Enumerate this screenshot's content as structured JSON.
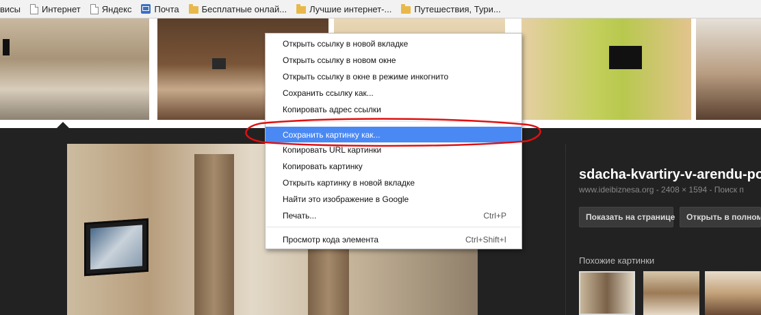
{
  "bookmarks": [
    {
      "label": "висы",
      "icon": "none"
    },
    {
      "label": "Интернет",
      "icon": "page-icon"
    },
    {
      "label": "Яндекс",
      "icon": "page-icon"
    },
    {
      "label": "Почта",
      "icon": "mail-icon"
    },
    {
      "label": "Бесплатные онлай...",
      "icon": "folder-icon"
    },
    {
      "label": "Лучшие интернет-...",
      "icon": "folder-icon"
    },
    {
      "label": "Путешествия, Тури...",
      "icon": "folder-icon"
    }
  ],
  "context_menu": {
    "items": [
      {
        "label": "Открыть ссылку в новой вкладке",
        "shortcut": ""
      },
      {
        "label": "Открыть ссылку в новом окне",
        "shortcut": ""
      },
      {
        "label": "Открыть ссылку в окне в режиме инкогнито",
        "shortcut": ""
      },
      {
        "label": "Сохранить ссылку как...",
        "shortcut": ""
      },
      {
        "label": "Копировать адрес ссылки",
        "shortcut": ""
      },
      {
        "label": "Сохранить картинку как...",
        "shortcut": "",
        "highlighted": true
      },
      {
        "label": "Копировать URL картинки",
        "shortcut": ""
      },
      {
        "label": "Копировать картинку",
        "shortcut": ""
      },
      {
        "label": "Открыть картинку в новой вкладке",
        "shortcut": ""
      },
      {
        "label": "Найти это изображение в Google",
        "shortcut": ""
      },
      {
        "label": "Печать...",
        "shortcut": "Ctrl+P"
      },
      {
        "label": "Просмотр кода элемента",
        "shortcut": "Ctrl+Shift+I"
      }
    ],
    "highlight_color": "#4a89f3"
  },
  "detail": {
    "title": "sdacha-kvartiry-v-arendu-po",
    "meta": "www.ideibiznesa.org - 2408 × 1594 - Поиск п",
    "visit_button": "Показать на странице",
    "open_full_button": "Открыть в полном р",
    "similar_label": "Похожие картинки"
  },
  "annotation_color": "#e01010"
}
